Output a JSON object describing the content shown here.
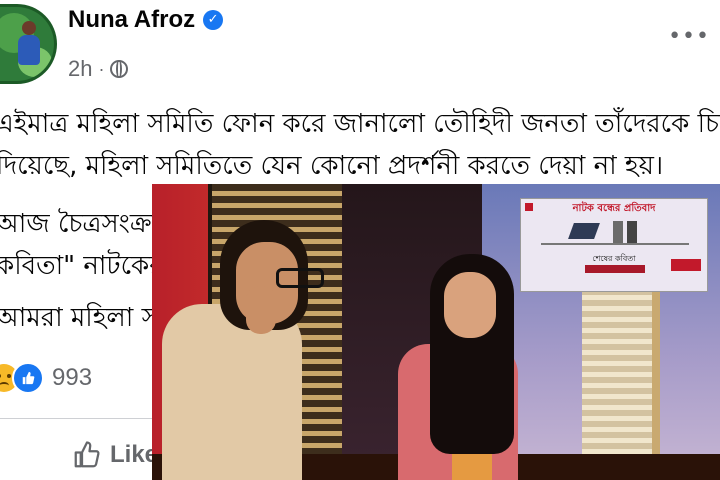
{
  "post": {
    "author": "Nuna Afroz",
    "time": "2h",
    "lines": [
      "এইমাত্র মহিলা সমিতি ফোন করে জানালো তৌহিদী জনতা তাঁদেরকে চিঠি",
      "দিয়েছে, মহিলা সমিতিতে যেন কোনো প্রদর্শনী  করতে দেয়া না হয়।",
      "আজ চৈত্রসংক্রা",
      "কবিতা\" নাটকের",
      "আমরা মহিলা স"
    ],
    "reaction_count": "993",
    "like_label": "Like"
  },
  "poster": {
    "title": "নাটক বন্ধের প্রতিবাদ",
    "play_name": "শেষের কবিতা"
  },
  "colors": {
    "brand": "#1877f2",
    "secondary_text": "#65676b",
    "poster_red": "#c2192b"
  },
  "icons": [
    "verified-badge-icon",
    "globe-icon",
    "more-options-icon",
    "sad-reaction-icon",
    "like-reaction-icon",
    "thumbs-up-icon"
  ]
}
